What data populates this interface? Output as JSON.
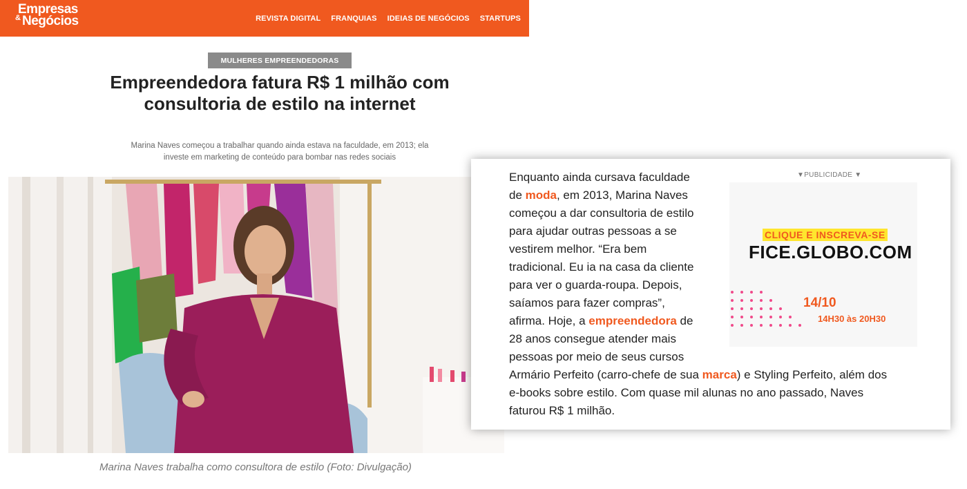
{
  "header": {
    "logo_line1": "Empresas",
    "logo_amp": "&",
    "logo_line2": "Negócios",
    "nav": [
      "REVISTA DIGITAL",
      "FRANQUIAS",
      "IDEIAS DE NEGÓCIOS",
      "STARTUPS"
    ],
    "brand_color": "#f0591f"
  },
  "article": {
    "category": "MULHERES EMPREENDEDORAS",
    "title": "Empreendedora fatura R$ 1 milhão com consultoria de estilo na internet",
    "subtitle": "Marina Naves começou a trabalhar quando ainda estava na faculdade, em 2013; ela investe em marketing de conteúdo para bombar nas redes sociais",
    "caption": "Marina Naves trabalha como consultora de estilo (Foto: Divulgação)"
  },
  "card": {
    "lines": [
      [
        "Enquanto ainda cursava faculdade"
      ],
      [
        "de ",
        {
          "hl": "moda"
        },
        ", em 2013, Marina Naves"
      ],
      [
        "começou a dar consultoria de estilo"
      ],
      [
        "para ajudar outras pessoas a se"
      ],
      [
        "vestirem melhor. “Era bem"
      ],
      [
        "tradicional. Eu ia na casa da cliente"
      ],
      [
        "para ver o guarda-roupa. Depois,"
      ],
      [
        "saíamos para fazer compras”,"
      ],
      [
        "afirma. Hoje, a ",
        {
          "hl": "empreendedora"
        },
        " de"
      ],
      [
        "28 anos consegue atender mais"
      ],
      [
        "pessoas por meio de seus cursos"
      ],
      [
        "Armário Perfeito (carro-chefe de sua ",
        {
          "hl": "marca"
        },
        ") e Styling Perfeito, além dos"
      ],
      [
        "e-books sobre estilo. Com quase mil alunas no ano passado, Naves"
      ],
      [
        "faturou R$ 1 milhão."
      ]
    ],
    "ad": {
      "label": "▼PUBLICIDADE ▼",
      "cta": "CLIQUE E INSCREVA-SE",
      "site": "FICE.GLOBO.COM",
      "date": "14/10",
      "time": "14H30 às 20H30"
    }
  }
}
